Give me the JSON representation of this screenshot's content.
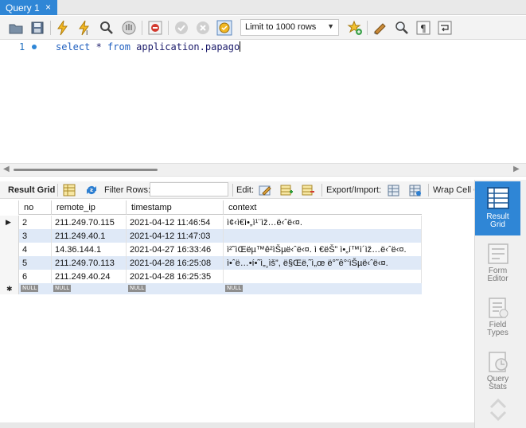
{
  "tab": {
    "label": "Query 1",
    "close": "×"
  },
  "toolbar": {
    "limit_select": "Limit to 1000 rows",
    "limit_arrow": "▼"
  },
  "editor": {
    "line_number": "1",
    "keyword_select": "select",
    "star": " * ",
    "keyword_from": "from",
    "table_name": " application.papago"
  },
  "result_toolbar": {
    "result_grid_label": "Result Grid",
    "filter_rows_label": "Filter Rows:",
    "filter_value": "",
    "edit_label": "Edit:",
    "export_import_label": "Export/Import:",
    "wrap_label": "Wrap Cell C"
  },
  "grid": {
    "headers": [
      "no",
      "remote_ip",
      "timestamp",
      "context"
    ],
    "rows": [
      {
        "no": "2",
        "remote_ip": "211.249.70.115",
        "timestamp": "2021-04-12 11:46:54",
        "context": "ì¢‹ì€ì•„ì¹¨ìž…ë‹ˆë‹¤."
      },
      {
        "no": "3",
        "remote_ip": "211.249.40.1",
        "timestamp": "2021-04-12 11:47:03",
        "context": ""
      },
      {
        "no": "4",
        "remote_ip": "14.36.144.1",
        "timestamp": "2021-04-27 16:33:46",
        "context": "ì²˜ìŒëµ™ê²ìŠµë‹ˆë‹¤. ì €ëŠ” ì•„í™ì´ìž…ë‹ˆë‹¤."
      },
      {
        "no": "5",
        "remote_ip": "211.249.70.113",
        "timestamp": "2021-04-28 16:25:08",
        "context": "ì•ˆë…•í•˜ì„¸ìš”, ë§Œë‚˜ì„œ ë°˜ê°‘ìŠµë‹ˆë‹¤."
      },
      {
        "no": "6",
        "remote_ip": "211.249.40.24",
        "timestamp": "2021-04-28 16:25:35",
        "context": ""
      }
    ],
    "null_label": "NULL"
  },
  "side_panel": {
    "items": [
      {
        "line1": "Result",
        "line2": "Grid"
      },
      {
        "line1": "Form",
        "line2": "Editor"
      },
      {
        "line1": "Field",
        "line2": "Types"
      },
      {
        "line1": "Query",
        "line2": "Stats"
      }
    ]
  },
  "colors": {
    "accent": "#2f86d6",
    "row_alt": "#dfe9f7",
    "keyword": "#1f5fbf"
  }
}
